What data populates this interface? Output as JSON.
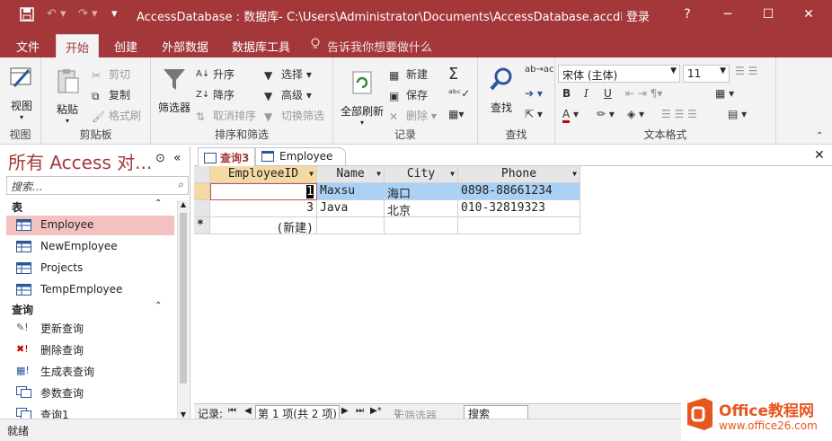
{
  "window": {
    "title": "AccessDatabase : 数据库- C:\\Users\\Administrator\\Documents\\AccessDatabase.accdb (Ac...",
    "login": "登录",
    "help_glyph": "?",
    "minimize_glyph": "─",
    "maximize_glyph": "☐",
    "close_glyph": "✕"
  },
  "ribbon_tabs": [
    {
      "label": "文件"
    },
    {
      "label": "开始",
      "active": true
    },
    {
      "label": "创建"
    },
    {
      "label": "外部数据"
    },
    {
      "label": "数据库工具"
    },
    {
      "label": "告诉我你想要做什么",
      "icon": "lightbulb-icon"
    }
  ],
  "ribbon": {
    "groups": {
      "view": "视图",
      "clipboard": "剪贴板",
      "sort_filter": "排序和筛选",
      "records": "记录",
      "find": "查找",
      "text_format": "文本格式"
    },
    "view_button": "视图",
    "paste_button": "粘贴",
    "cut": "剪切",
    "copy": "复制",
    "format_painter": "格式刷",
    "filter_button": "筛选器",
    "ascending": "升序",
    "descending": "降序",
    "remove_sort": "取消排序",
    "selection": "选择",
    "advanced": "高级",
    "toggle_filter": "切换筛选",
    "refresh_all": "全部刷新",
    "new": "新建",
    "save": "保存",
    "delete": "删除",
    "find_button": "查找",
    "font_name": "宋体 (主体)",
    "font_size": "11"
  },
  "nav_pane": {
    "title": "所有 Access 对...",
    "search_placeholder": "搜索...",
    "sections": [
      {
        "label": "表",
        "items": [
          "Employee",
          "NewEmployee",
          "Projects",
          "TempEmployee"
        ]
      },
      {
        "label": "查询",
        "items": [
          "更新查询",
          "删除查询",
          "生成表查询",
          "参数查询",
          "查询1"
        ]
      }
    ],
    "selected": "Employee"
  },
  "doc_tabs": [
    {
      "label": "查询3",
      "active": true
    },
    {
      "label": "Employee",
      "active": false
    }
  ],
  "datasheet": {
    "columns": [
      "EmployeeID",
      "Name",
      "City",
      "Phone"
    ],
    "rows": [
      [
        "1",
        "Maxsu",
        "海口",
        "0898-88661234"
      ],
      [
        "3",
        "Java",
        "北京",
        "010-32819323"
      ]
    ],
    "new_row_label": "(新建)",
    "new_row_marker": "*"
  },
  "record_nav": {
    "label": "记录:",
    "position": "第 1 项(共 2 项)",
    "filter": "无筛选器",
    "search": "搜索"
  },
  "status": {
    "text": "就绪"
  },
  "watermark": {
    "brand": "Office教程网",
    "url": "www.office26.com"
  },
  "colors": {
    "accent": "#a4373a",
    "selected_row": "#a9d1f5",
    "nav_selected": "#f4c1c1"
  }
}
